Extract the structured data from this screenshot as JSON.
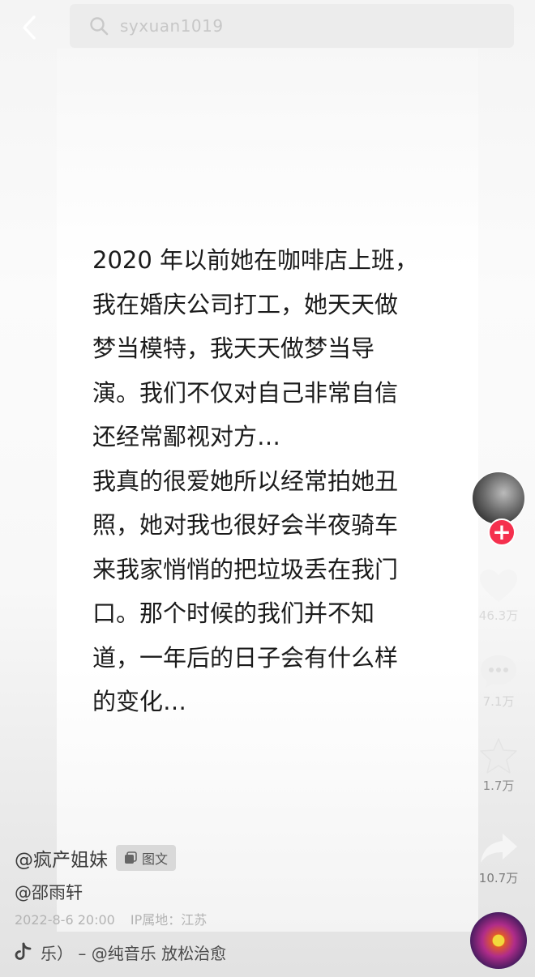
{
  "search": {
    "query": "syxuan1019"
  },
  "post": {
    "lines": [
      "2020 年以前她在咖啡店上班，",
      "我在婚庆公司打工，她天天做",
      "梦当模特，我天天做梦当导",
      "演。我们不仅对自己非常自信",
      "还经常鄙视对方…",
      "我真的很爱她所以经常拍她丑",
      "照，她对我也很好会半夜骑车",
      "来我家悄悄的把垃圾丢在我门",
      "口。那个时候的我们并不知",
      "道，一年后的日子会有什么样",
      "的变化…"
    ]
  },
  "actions": {
    "likes": "46.3万",
    "comments": "7.1万",
    "favorites": "1.7万",
    "shares": "10.7万"
  },
  "info": {
    "author": "@疯产姐妹",
    "tag": "图文",
    "mention": "@邵雨轩",
    "date": "2022-8-6 20:00",
    "ip": "IP属地：江苏",
    "music": "乐） – @纯音乐    放松治愈"
  },
  "icons": [
    "back-icon",
    "search-icon",
    "plus-icon",
    "heart-icon",
    "comment-icon",
    "star-icon",
    "share-icon",
    "image-text-icon",
    "tiktok-note-icon"
  ],
  "colors": {
    "follow": "#f5304e",
    "text": "#1b1b1b",
    "meta": "#b3b3b3"
  }
}
